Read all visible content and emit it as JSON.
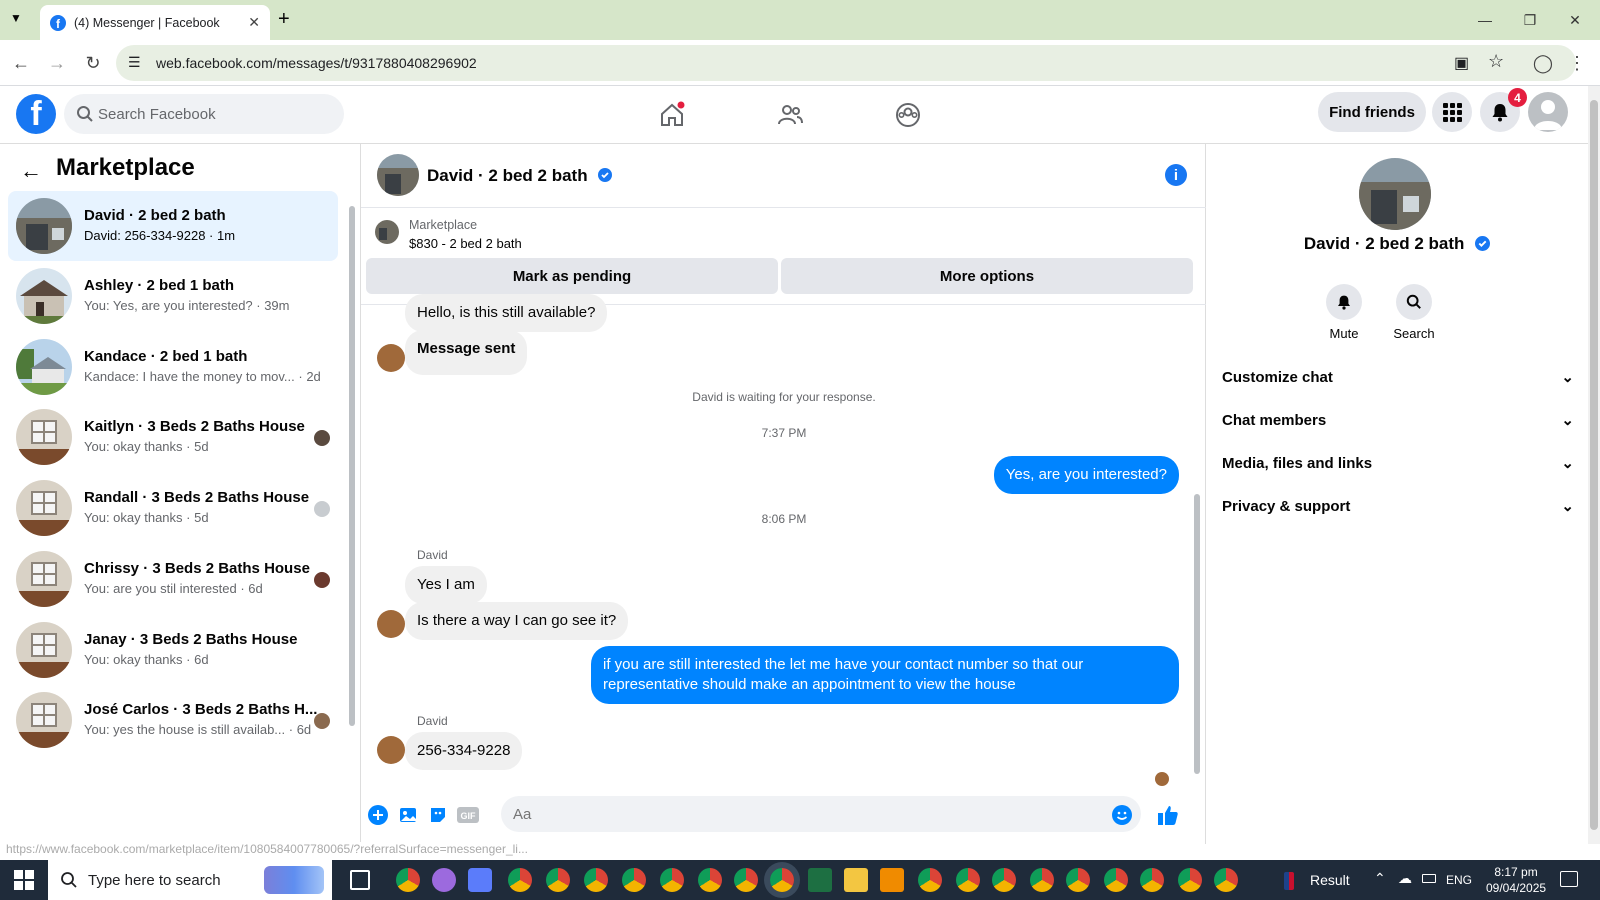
{
  "browser": {
    "tab_title": "(4) Messenger | Facebook",
    "url": "web.facebook.com/messages/t/9317880408296902",
    "status_url": "https://www.facebook.com/marketplace/item/1080584007780065/?referralSurface=messenger_li..."
  },
  "header": {
    "search_placeholder": "Search Facebook",
    "find_friends": "Find friends",
    "notification_count": "4"
  },
  "sidebar": {
    "title": "Marketplace",
    "conversations": [
      {
        "name": "David · 2 bed 2 bath",
        "preview": "David: 256-334-9228 · 1m"
      },
      {
        "name": "Ashley · 2 bed 1 bath",
        "preview": "You: Yes, are you interested? · 39m"
      },
      {
        "name": "Kandace · 2 bed 1 bath",
        "preview": "Kandace: I have the money to mov...  · 2d"
      },
      {
        "name": "Kaitlyn · 3 Beds 2 Baths House",
        "preview": "You: okay thanks · 5d"
      },
      {
        "name": "Randall · 3 Beds 2 Baths House",
        "preview": "You: okay thanks · 5d"
      },
      {
        "name": "Chrissy · 3 Beds 2 Baths House",
        "preview": "You: are you stil interested · 6d"
      },
      {
        "name": "Janay · 3 Beds 2 Baths House",
        "preview": "You: okay thanks · 6d"
      },
      {
        "name": "José Carlos · 3 Beds 2 Baths H...",
        "preview": "You: yes the house is still availab... · 6d"
      }
    ]
  },
  "chat": {
    "name": "David · 2 bed 2 bath",
    "marketplace_label": "Marketplace",
    "listing": "$830 - 2 bed 2 bath",
    "mark_pending": "Mark as pending",
    "more_options": "More options",
    "messages": {
      "m1": "Hello, is this still available?",
      "m2": "Message sent",
      "waiting": "David is waiting for your response.",
      "time1": "7:37 PM",
      "m3": "Yes, are you interested?",
      "time2": "8:06 PM",
      "sender1": "David",
      "m4": "Yes I am",
      "m5": "Is there a way I can go see it?",
      "m6": "if you are still interested the let me have your contact number so that our representative should make an appointment to view the house",
      "sender2": "David",
      "m7": "256-334-9228"
    },
    "composer_placeholder": "Aa"
  },
  "right_panel": {
    "name": "David · 2 bed 2 bath",
    "mute": "Mute",
    "search": "Search",
    "sections": [
      "Customize chat",
      "Chat members",
      "Media, files and links",
      "Privacy & support"
    ]
  },
  "taskbar": {
    "search_placeholder": "Type here to search",
    "result": "Result",
    "lang": "ENG",
    "time": "8:17 pm",
    "date": "09/04/2025"
  },
  "colors": {
    "brand": "#1877f2",
    "outgoing_bubble": "#0084ff",
    "active_row": "#e7f3ff"
  }
}
